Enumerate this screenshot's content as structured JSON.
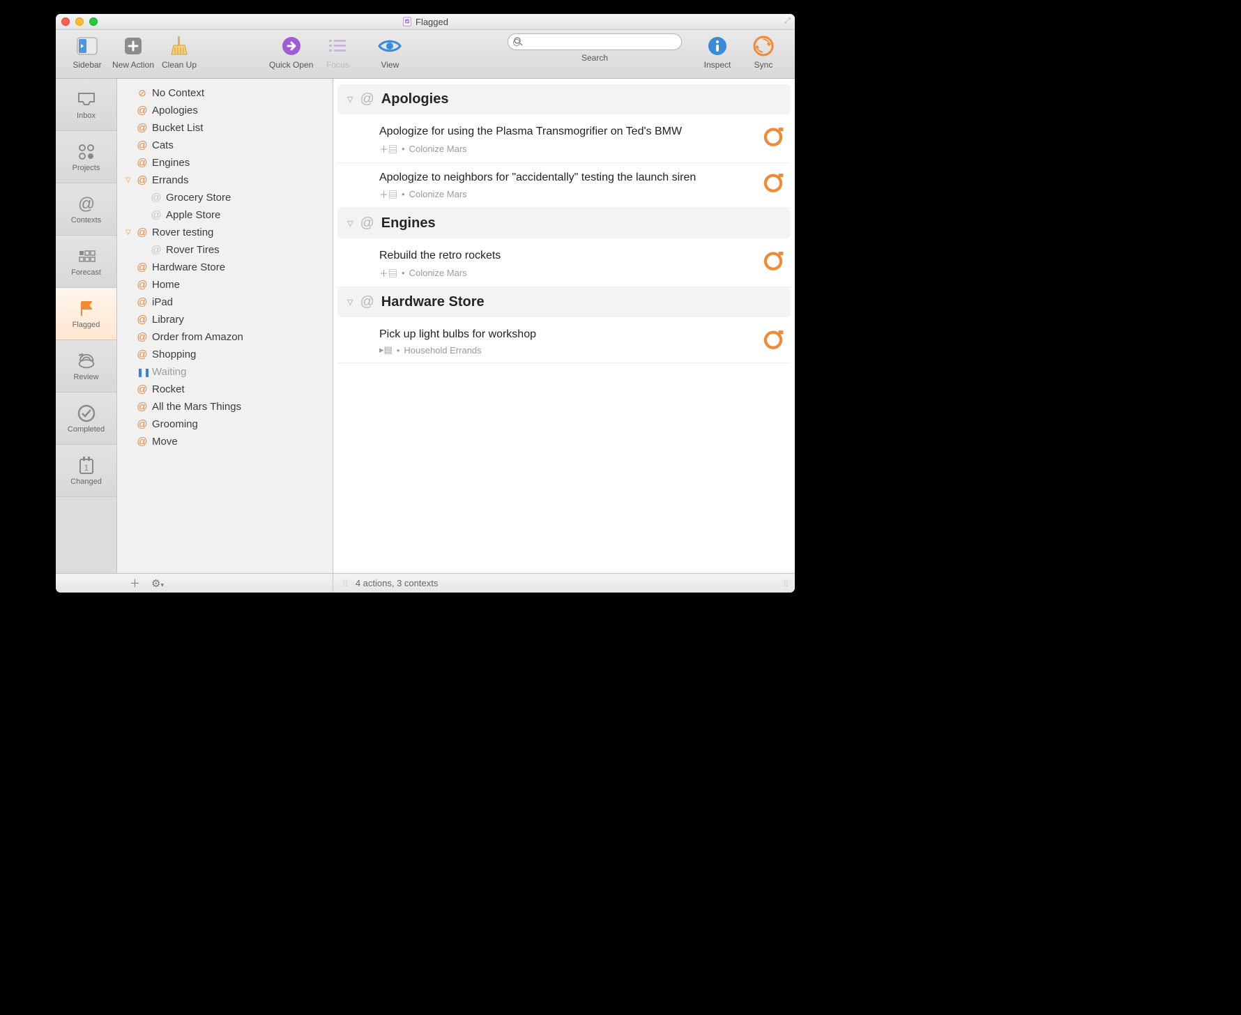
{
  "window": {
    "title": "Flagged"
  },
  "toolbar": {
    "sidebar": "Sidebar",
    "new_action": "New Action",
    "clean_up": "Clean Up",
    "quick_open": "Quick Open",
    "focus": "Focus",
    "view": "View",
    "search_label": "Search",
    "search_placeholder": "",
    "inspect": "Inspect",
    "sync": "Sync"
  },
  "perspectives": [
    {
      "id": "inbox",
      "label": "Inbox"
    },
    {
      "id": "projects",
      "label": "Projects"
    },
    {
      "id": "contexts",
      "label": "Contexts"
    },
    {
      "id": "forecast",
      "label": "Forecast"
    },
    {
      "id": "flagged",
      "label": "Flagged",
      "selected": true
    },
    {
      "id": "review",
      "label": "Review"
    },
    {
      "id": "completed",
      "label": "Completed"
    },
    {
      "id": "changed",
      "label": "Changed"
    }
  ],
  "contexts": [
    {
      "label": "No Context",
      "kind": "no-context"
    },
    {
      "label": "Apologies"
    },
    {
      "label": "Bucket List"
    },
    {
      "label": "Cats"
    },
    {
      "label": "Engines"
    },
    {
      "label": "Errands",
      "expanded": true,
      "children": [
        {
          "label": "Grocery Store"
        },
        {
          "label": "Apple Store"
        }
      ]
    },
    {
      "label": "Rover testing",
      "expanded": true,
      "children": [
        {
          "label": "Rover Tires"
        }
      ]
    },
    {
      "label": "Hardware Store"
    },
    {
      "label": "Home"
    },
    {
      "label": "iPad"
    },
    {
      "label": "Library"
    },
    {
      "label": "Order from Amazon"
    },
    {
      "label": "Shopping"
    },
    {
      "label": "Waiting",
      "kind": "paused"
    },
    {
      "label": "Rocket"
    },
    {
      "label": "All the Mars Things"
    },
    {
      "label": "Grooming"
    },
    {
      "label": "Move"
    }
  ],
  "groups": [
    {
      "title": "Apologies",
      "tasks": [
        {
          "title": "Apologize for using the Plasma Transmogrifier on Ted's BMW",
          "project": "Colonize Mars",
          "meta_kind": "plus"
        },
        {
          "title": "Apologize to neighbors for \"accidentally\" testing the launch siren",
          "project": "Colonize Mars",
          "meta_kind": "plus"
        }
      ]
    },
    {
      "title": "Engines",
      "tasks": [
        {
          "title": "Rebuild the retro rockets",
          "project": "Colonize Mars",
          "meta_kind": "plus"
        }
      ]
    },
    {
      "title": "Hardware Store",
      "tasks": [
        {
          "title": "Pick up light bulbs for workshop",
          "project": "Household Errands",
          "meta_kind": "arrow"
        }
      ]
    }
  ],
  "statusbar": {
    "summary": "4 actions, 3 contexts"
  },
  "colors": {
    "accent": "#f28a33"
  }
}
